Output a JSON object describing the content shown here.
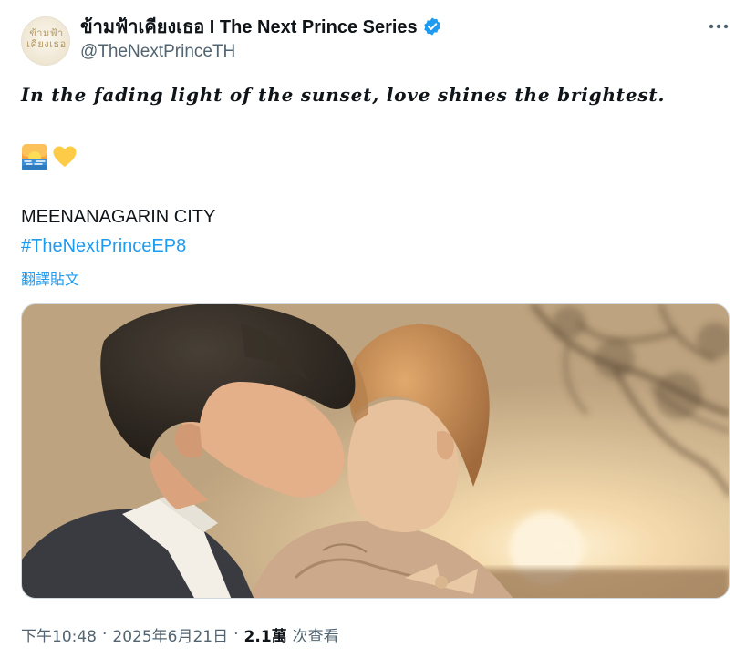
{
  "author": {
    "display_name": "ข้ามฟ้าเคียงเธอ I The Next Prince Series",
    "handle": "@TheNextPrinceTH",
    "verified_icon": "verified-badge-icon",
    "avatar_logo_line1": "ข้ามฟ้า",
    "avatar_logo_line2": "เคียงเธอ",
    "more_icon": "more-dots-icon"
  },
  "post": {
    "headline": "In the fading light of the sunset, love shines the brightest.",
    "emojis": [
      "sunrise-over-water-icon",
      "yellow-heart-icon"
    ],
    "location_line": "MEENANAGARIN CITY",
    "hashtag": "#TheNextPrinceEP8",
    "translate_label": "翻譯貼文"
  },
  "meta": {
    "time": "下午10:48",
    "date": "2025年6月21日",
    "separator": "·",
    "view_count": "2.1萬",
    "view_label": "次查看"
  },
  "colors": {
    "accent": "#1d9bf0",
    "text": "#0f1419",
    "secondary_text": "#536471",
    "border": "#cfd9de"
  }
}
